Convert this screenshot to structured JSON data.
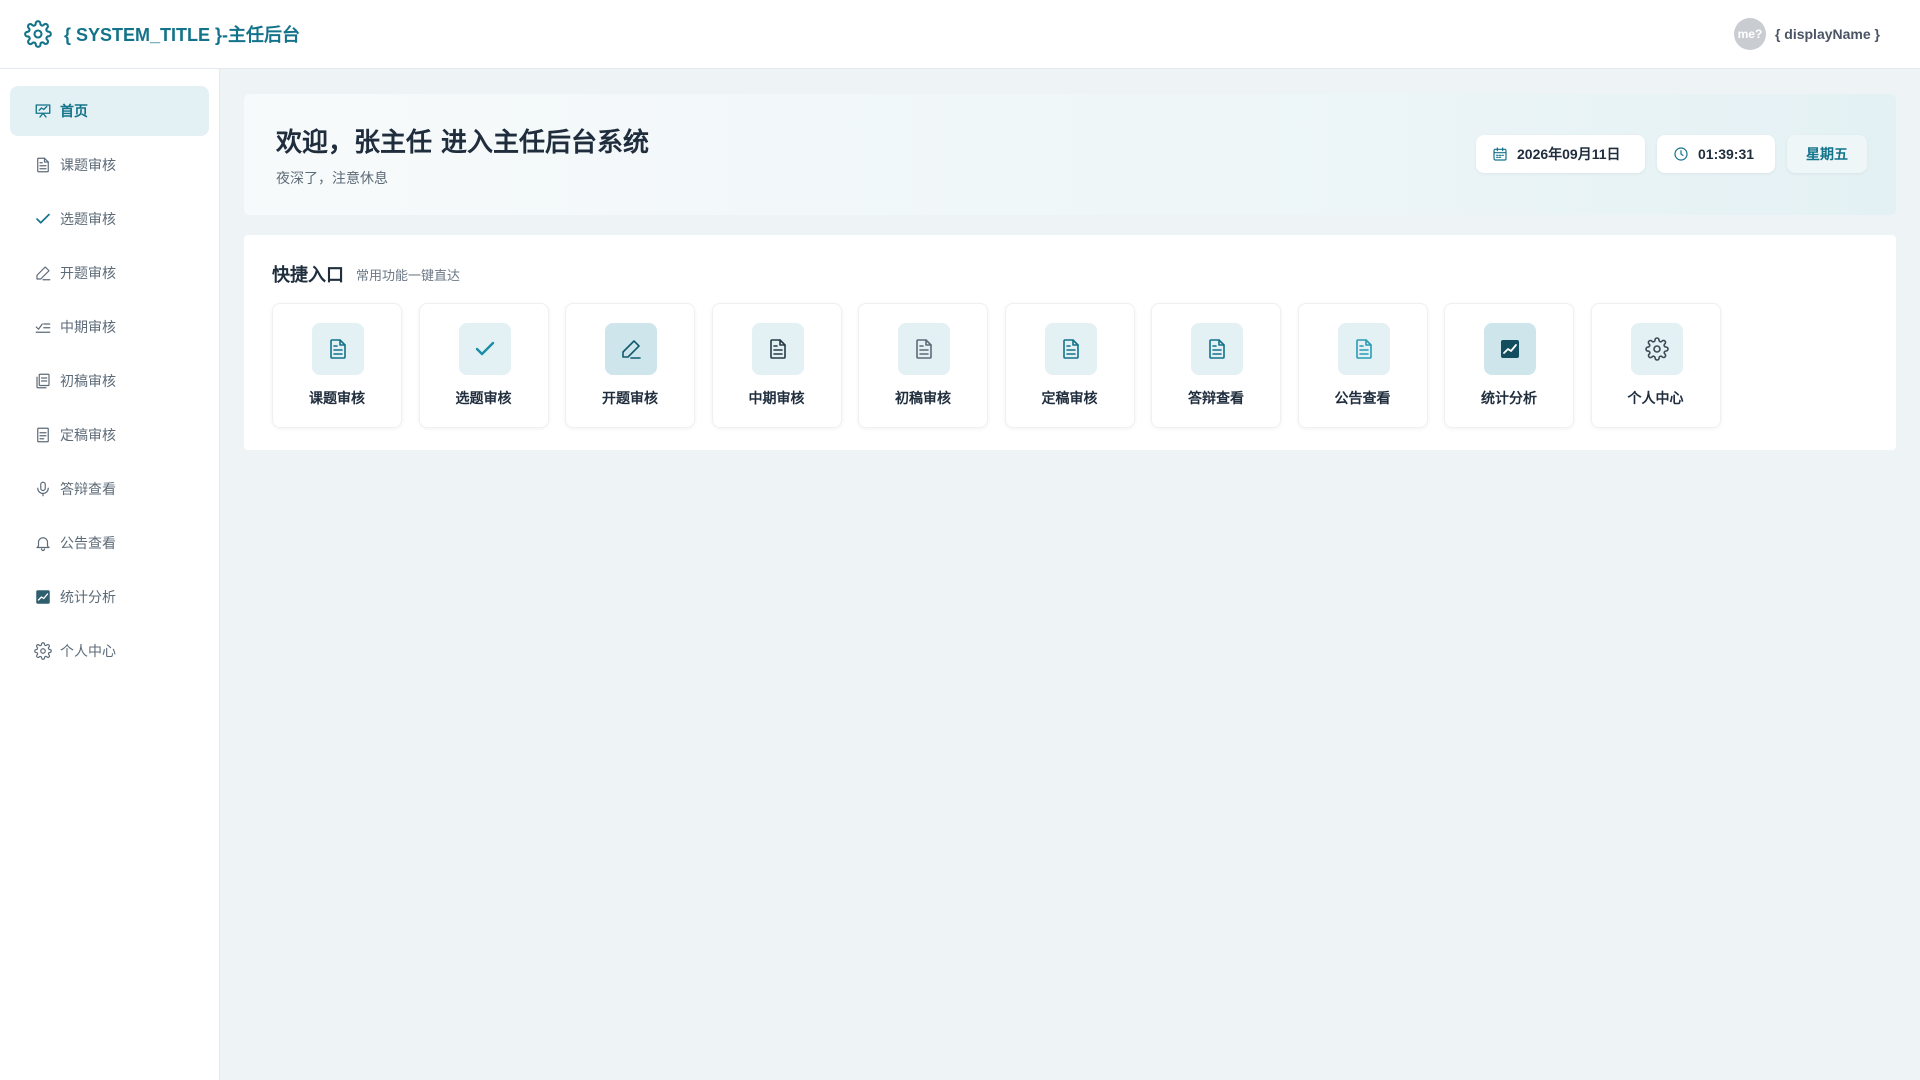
{
  "header": {
    "title": "{ SYSTEM_TITLE }-主任后台",
    "icon": "gear-icon",
    "avatar_text": "me?",
    "display_name": "{ displayName }"
  },
  "sidebar": {
    "items": [
      {
        "label": "首页",
        "icon": "home-board-icon",
        "active": true
      },
      {
        "label": "课题审核",
        "icon": "document-icon"
      },
      {
        "label": "选题审核",
        "icon": "check-icon"
      },
      {
        "label": "开题审核",
        "icon": "pen-icon"
      },
      {
        "label": "中期审核",
        "icon": "list-check-icon"
      },
      {
        "label": "初稿审核",
        "icon": "documents-icon"
      },
      {
        "label": "定稿审核",
        "icon": "document-icon"
      },
      {
        "label": "答辩查看",
        "icon": "microphone-icon"
      },
      {
        "label": "公告查看",
        "icon": "bell-icon"
      },
      {
        "label": "统计分析",
        "icon": "chart-icon"
      },
      {
        "label": "个人中心",
        "icon": "gear-icon"
      }
    ]
  },
  "welcome": {
    "title": "欢迎，张主任 进入主任后台系统",
    "subtitle": "夜深了，注意休息",
    "date": "2026年09月11日",
    "time": "01:39:31",
    "weekday": "星期五"
  },
  "quick": {
    "title": "快捷入口",
    "subtitle": "常用功能一键直达",
    "cards": [
      {
        "label": "课题审核",
        "icon": "document-icon"
      },
      {
        "label": "选题审核",
        "icon": "check-icon"
      },
      {
        "label": "开题审核",
        "icon": "pen-icon"
      },
      {
        "label": "中期审核",
        "icon": "document-icon"
      },
      {
        "label": "初稿审核",
        "icon": "document-icon"
      },
      {
        "label": "定稿审核",
        "icon": "document-icon"
      },
      {
        "label": "答辩查看",
        "icon": "document-icon"
      },
      {
        "label": "公告查看",
        "icon": "document-icon"
      },
      {
        "label": "统计分析",
        "icon": "chart-icon"
      },
      {
        "label": "个人中心",
        "icon": "gear-icon"
      }
    ]
  },
  "colors": {
    "accent": "#13738a",
    "active_bg": "#e3f1f5",
    "page_bg": "#eef3f6"
  }
}
